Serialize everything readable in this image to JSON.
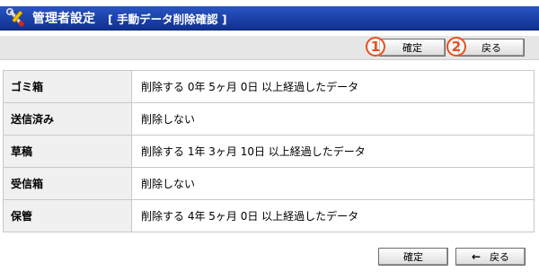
{
  "header": {
    "icon": "tools-icon",
    "title": "管理者設定",
    "subtitle": "[ 手動データ削除確認 ]"
  },
  "toolbar": {
    "confirm_label": "確定",
    "back_label": "戻る",
    "badge_1": "1",
    "badge_2": "2"
  },
  "rows": [
    {
      "label": "ゴミ箱",
      "value": "削除する 0年 5ヶ月 0日 以上経過したデータ"
    },
    {
      "label": "送信済み",
      "value": "削除しない"
    },
    {
      "label": "草稿",
      "value": "削除する 1年 3ヶ月 10日 以上経過したデータ"
    },
    {
      "label": "受信箱",
      "value": "削除しない"
    },
    {
      "label": "保管",
      "value": "削除する 4年 5ヶ月 0日 以上経過したデータ"
    }
  ],
  "footer": {
    "confirm_label": "確定",
    "back_label": "戻る",
    "back_arrow": "←"
  },
  "colors": {
    "titlebar": "#1f46b3",
    "badge": "#e8501c",
    "label_bg": "#f0f0f0"
  }
}
